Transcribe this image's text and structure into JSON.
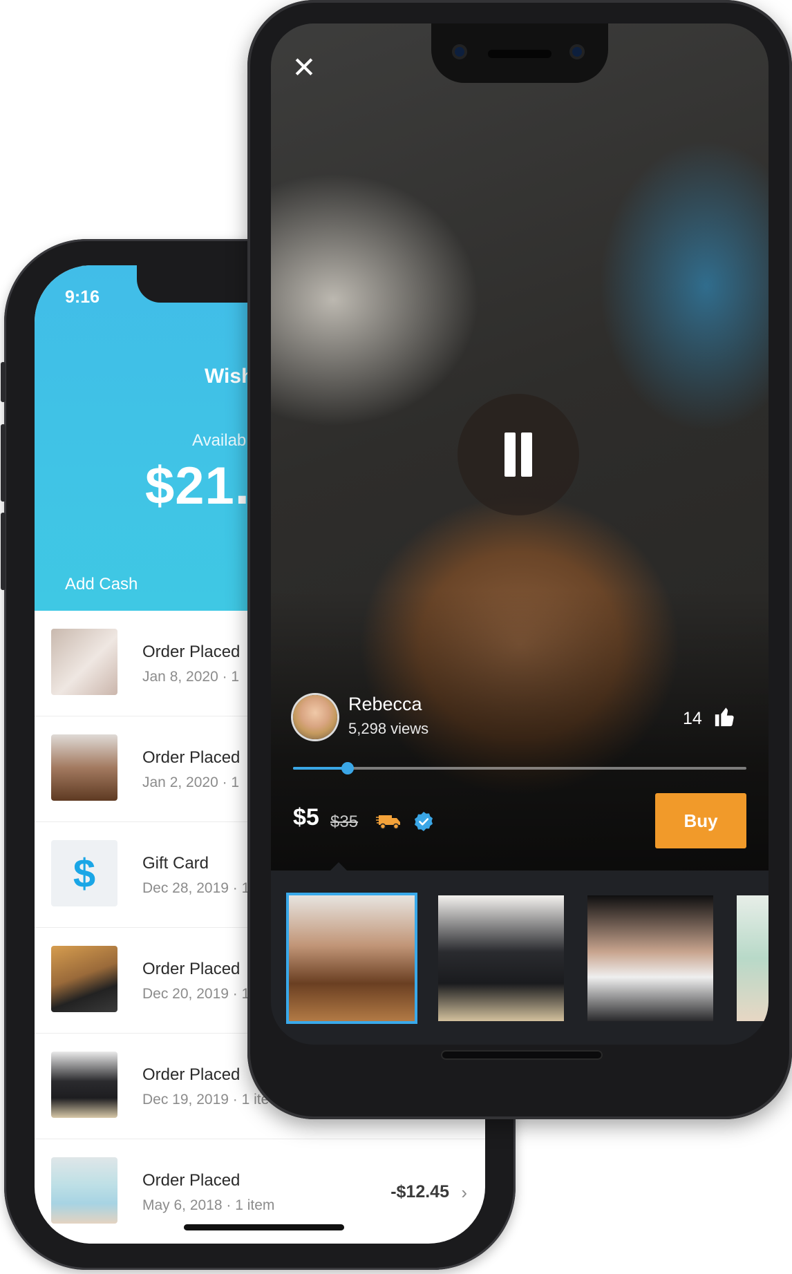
{
  "wallet": {
    "status_time": "9:16",
    "title": "Wish",
    "available_label": "Availab",
    "balance": "$21.1",
    "add_cash": "Add Cash",
    "rows": [
      {
        "title": "Order Placed",
        "subtitle": "Jan 8, 2020 · 1",
        "thumb": "airpods"
      },
      {
        "title": "Order Placed",
        "subtitle": "Jan 2, 2020 · 1",
        "thumb": "diffuser"
      },
      {
        "title": "Gift Card",
        "subtitle": "Dec 28, 2019 · 1",
        "thumb": "dollar-icon",
        "icon_glyph": "$"
      },
      {
        "title": "Order Placed",
        "subtitle": "Dec 20, 2019 · 1",
        "thumb": "cable-holder"
      },
      {
        "title": "Order Placed",
        "subtitle": "Dec 19, 2019 · 1 ite",
        "thumb": "speaker"
      },
      {
        "title": "Order Placed",
        "subtitle": "May 6, 2018 · 1 item",
        "thumb": "pillows",
        "amount": "-$12.45"
      }
    ]
  },
  "video": {
    "close_icon": "close-icon",
    "pause_icon": "pause-icon",
    "author": "Rebecca",
    "views": "5,298 views",
    "likes": "14",
    "like_icon": "thumbs-up-icon",
    "progress": 0.12,
    "price": "$5",
    "old_price": "$35",
    "shipping_icon": "truck-icon",
    "verified_icon": "verified-check-icon",
    "buy_label": "Buy",
    "accent_color": "#39a9ea",
    "buy_color": "#f19a2a",
    "thumbnails": [
      "diffuser",
      "speaker",
      "airpods",
      "pillows"
    ]
  }
}
